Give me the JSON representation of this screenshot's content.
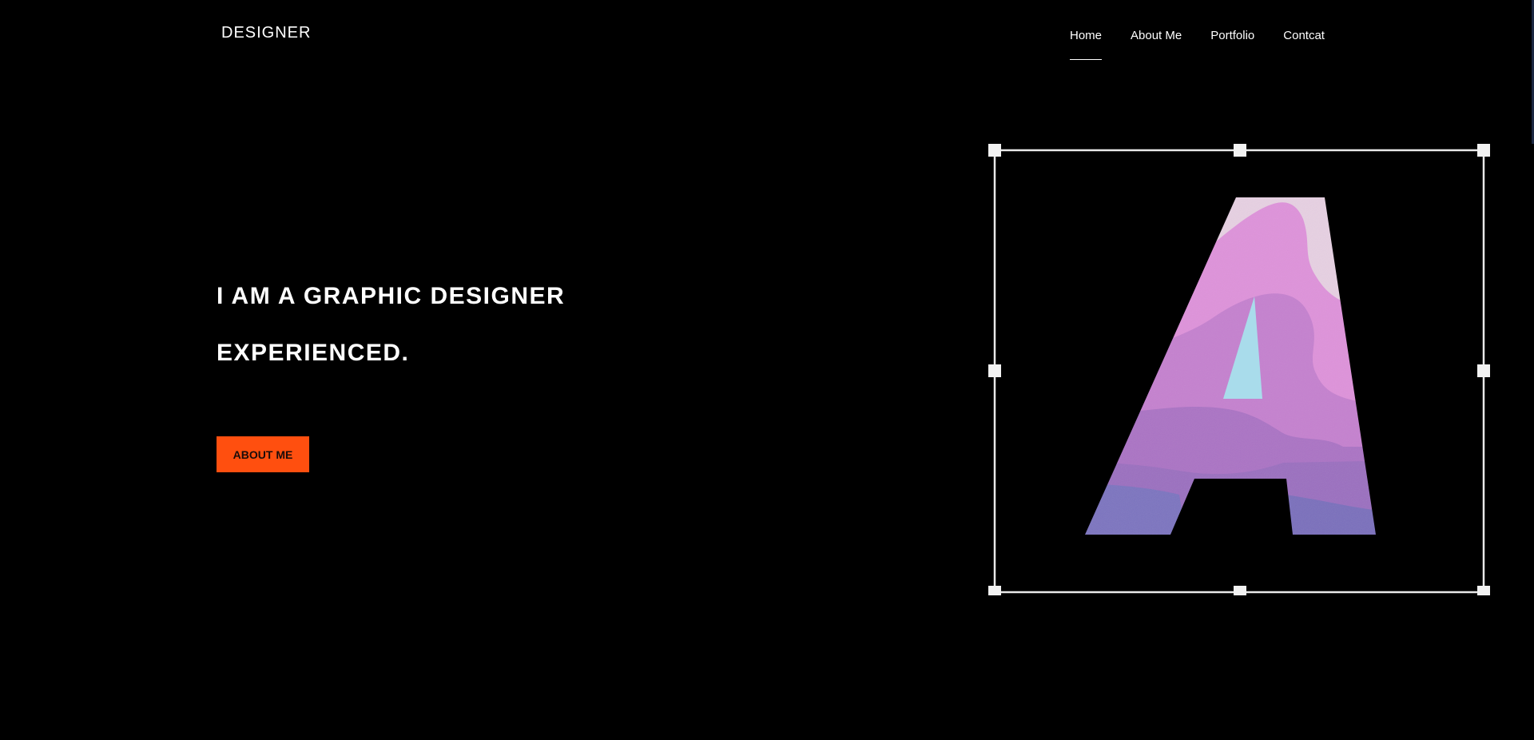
{
  "header": {
    "brand": "DESIGNER",
    "nav": [
      {
        "label": "Home",
        "active": true
      },
      {
        "label": "About Me",
        "active": false
      },
      {
        "label": "Portfolio",
        "active": false
      },
      {
        "label": "Contcat",
        "active": false
      }
    ]
  },
  "hero": {
    "line1": "I AM A GRAPHIC DESIGNER",
    "line2": "EXPERIENCED.",
    "cta_label": "ABOUT ME"
  },
  "colors": {
    "background": "#000000",
    "text": "#ffffff",
    "accent": "#ff4f0f"
  },
  "artwork": {
    "icon": "letter-a-papercut-icon",
    "selection": "transform-selection-box"
  }
}
